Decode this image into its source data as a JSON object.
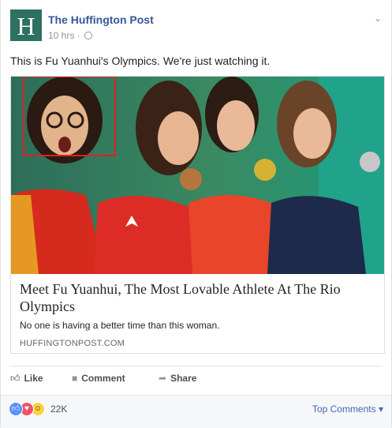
{
  "post": {
    "page_name": "The Huffington Post",
    "logo_letter": "H",
    "time": "10 hrs",
    "separator": "·",
    "text": "This is Fu Yuanhui's Olympics. We're just watching it."
  },
  "link_card": {
    "title": "Meet Fu Yuanhui, The Most Lovable Athlete At The Rio Olympics",
    "description": "No one is having a better time than this woman.",
    "domain": "HUFFINGTONPOST.COM"
  },
  "actions": {
    "like": "Like",
    "comment": "Comment",
    "share": "Share"
  },
  "reactions": {
    "count": "22K",
    "sort_label": "Top Comments"
  },
  "colors": {
    "link_blue": "#365899",
    "logo_green": "#2e7061",
    "like_blue": "#5890ff",
    "love_red": "#f25268",
    "haha_yellow": "#fdd140"
  }
}
